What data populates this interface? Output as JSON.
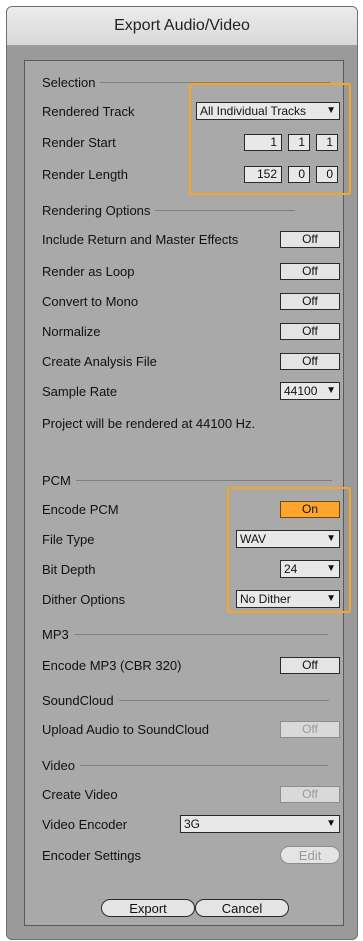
{
  "window": {
    "title": "Export Audio/Video"
  },
  "selection": {
    "heading": "Selection",
    "rendered_track_label": "Rendered Track",
    "rendered_track_value": "All Individual Tracks",
    "render_start_label": "Render Start",
    "render_start": [
      "1",
      "1",
      "1"
    ],
    "render_length_label": "Render Length",
    "render_length": [
      "152",
      "0",
      "0"
    ]
  },
  "rendering": {
    "heading": "Rendering Options",
    "items": [
      {
        "label": "Include Return and Master Effects",
        "value": "Off"
      },
      {
        "label": "Render as Loop",
        "value": "Off"
      },
      {
        "label": "Convert to Mono",
        "value": "Off"
      },
      {
        "label": "Normalize",
        "value": "Off"
      },
      {
        "label": "Create Analysis File",
        "value": "Off"
      }
    ],
    "sample_rate_label": "Sample Rate",
    "sample_rate_value": "44100",
    "info": "Project will be rendered at 44100 Hz."
  },
  "pcm": {
    "heading": "PCM",
    "encode_label": "Encode PCM",
    "encode_value": "On",
    "file_type_label": "File Type",
    "file_type_value": "WAV",
    "bit_depth_label": "Bit Depth",
    "bit_depth_value": "24",
    "dither_label": "Dither Options",
    "dither_value": "No Dither"
  },
  "mp3": {
    "heading": "MP3",
    "encode_label": "Encode MP3 (CBR 320)",
    "encode_value": "Off"
  },
  "soundcloud": {
    "heading": "SoundCloud",
    "upload_label": "Upload Audio to SoundCloud",
    "upload_value": "Off"
  },
  "video": {
    "heading": "Video",
    "create_label": "Create Video",
    "create_value": "Off",
    "encoder_label": "Video Encoder",
    "encoder_value": "3G",
    "settings_label": "Encoder Settings",
    "settings_button": "Edit"
  },
  "footer": {
    "export": "Export",
    "cancel": "Cancel"
  },
  "colors": {
    "highlight": "#f5a623",
    "on": "#ffa42d"
  },
  "icons": {
    "dropdown": "triangle-down-icon"
  }
}
